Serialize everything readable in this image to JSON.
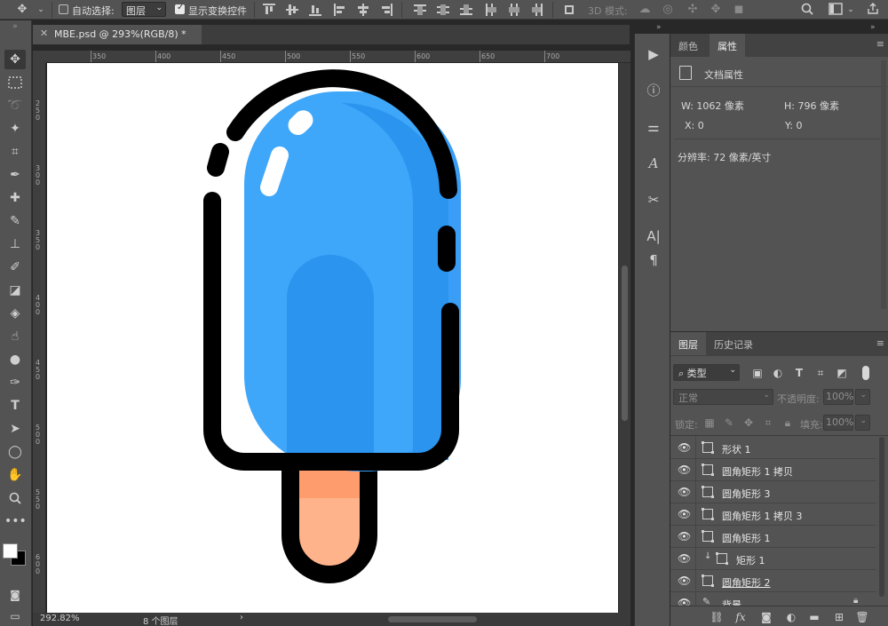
{
  "options_bar": {
    "auto_select_label": "自动选择:",
    "auto_select_checked": false,
    "auto_select_target": "图层",
    "show_transform_label": "显示变换控件",
    "show_transform_checked": true,
    "mode_3d_label": "3D 模式:"
  },
  "document": {
    "tab_title": "MBE.psd @ 293%(RGB/8) *",
    "ruler_top": [
      "350",
      "400",
      "450",
      "500",
      "550",
      "600",
      "650",
      "700"
    ],
    "ruler_left": [
      "2 5 0",
      "3 0 0",
      "3 5 0",
      "4 0 0",
      "4 5 0",
      "5 0 0",
      "5 5 0",
      "6 0 0"
    ],
    "zoom": "292.82%",
    "layer_count": "8 个图层",
    "artwork_colors": {
      "outline": "#000000",
      "body_light": "#3fa7fa",
      "body_dark": "#2a94ef",
      "body_shadow": "#3a9ef6",
      "stick_top": "#ff9c6e",
      "stick": "#ffb38a",
      "highlight": "#ffffff"
    }
  },
  "properties_panel": {
    "tabs": [
      "颜色",
      "属性"
    ],
    "active_tab": "属性",
    "header": "文档属性",
    "width": "W: 1062 像素",
    "height": "H: 796 像素",
    "x": "X: 0",
    "y": "Y: 0",
    "resolution": "分辨率: 72 像素/英寸"
  },
  "layers_panel": {
    "tabs": [
      "图层",
      "历史记录"
    ],
    "active_tab": "图层",
    "filter_label": "类型",
    "blend_mode": "正常",
    "opacity_label": "不透明度:",
    "opacity_value": "100%",
    "lock_label": "锁定:",
    "fill_label": "填充:",
    "fill_value": "100%",
    "layers": [
      {
        "name": "形状 1",
        "clipped": false,
        "underline": false
      },
      {
        "name": "圆角矩形 1 拷贝",
        "clipped": false,
        "underline": false
      },
      {
        "name": "圆角矩形 3",
        "clipped": false,
        "underline": false
      },
      {
        "name": "圆角矩形 1 拷贝 3",
        "clipped": false,
        "underline": false
      },
      {
        "name": "圆角矩形 1",
        "clipped": false,
        "underline": false
      },
      {
        "name": "矩形 1",
        "clipped": true,
        "underline": false
      },
      {
        "name": "圆角矩形 2",
        "clipped": false,
        "underline": true
      },
      {
        "name": "背景",
        "clipped": false,
        "underline": false
      }
    ]
  },
  "icons": {
    "move_tool": "move-icon",
    "search": "search-icon",
    "workspace": "workspace-icon",
    "share": "share-icon"
  }
}
